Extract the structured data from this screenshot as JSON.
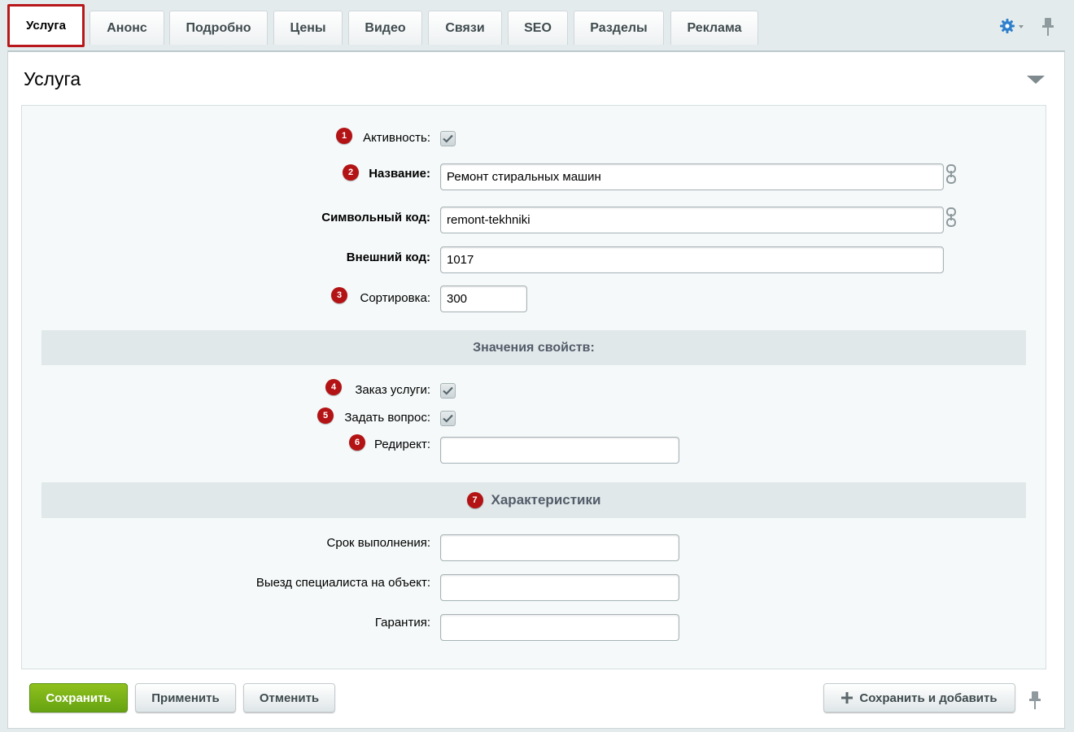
{
  "tabs": [
    {
      "label": "Услуга",
      "active": true
    },
    {
      "label": "Анонс"
    },
    {
      "label": "Подробно"
    },
    {
      "label": "Цены"
    },
    {
      "label": "Видео"
    },
    {
      "label": "Связи"
    },
    {
      "label": "SEO"
    },
    {
      "label": "Разделы"
    },
    {
      "label": "Реклама"
    }
  ],
  "toolbar": {
    "settings_icon": "gear-icon",
    "pin_icon": "pin-icon"
  },
  "section": {
    "title": "Услуга"
  },
  "fields": {
    "active": {
      "badge": "1",
      "label": "Активность:",
      "checked": true
    },
    "name": {
      "badge": "2",
      "label": "Название:",
      "value": "Ремонт стиральных машин"
    },
    "code": {
      "label": "Символьный код:",
      "value": "remont-tekhniki"
    },
    "external_code": {
      "label": "Внешний код:",
      "value": "1017"
    },
    "sort": {
      "badge": "3",
      "label": "Сортировка:",
      "value": "300"
    }
  },
  "properties": {
    "header": "Значения свойств:",
    "order": {
      "badge": "4",
      "label": "Заказ услуги:",
      "checked": true
    },
    "question": {
      "badge": "5",
      "label": "Задать вопрос:",
      "checked": true
    },
    "redirect": {
      "badge": "6",
      "label": "Редирект:",
      "value": ""
    }
  },
  "characteristics": {
    "badge": "7",
    "header": "Характеристики",
    "term": {
      "label": "Срок выполнения:",
      "value": ""
    },
    "visit": {
      "label": "Выезд специалиста на объект:",
      "value": ""
    },
    "warranty": {
      "label": "Гарантия:",
      "value": ""
    }
  },
  "footer": {
    "save": "Сохранить",
    "apply": "Применить",
    "cancel": "Отменить",
    "save_add": "Сохранить и добавить"
  },
  "colors": {
    "accent_red": "#b8171b",
    "save_green": "#7db218",
    "gear_blue": "#2f7fcc"
  }
}
